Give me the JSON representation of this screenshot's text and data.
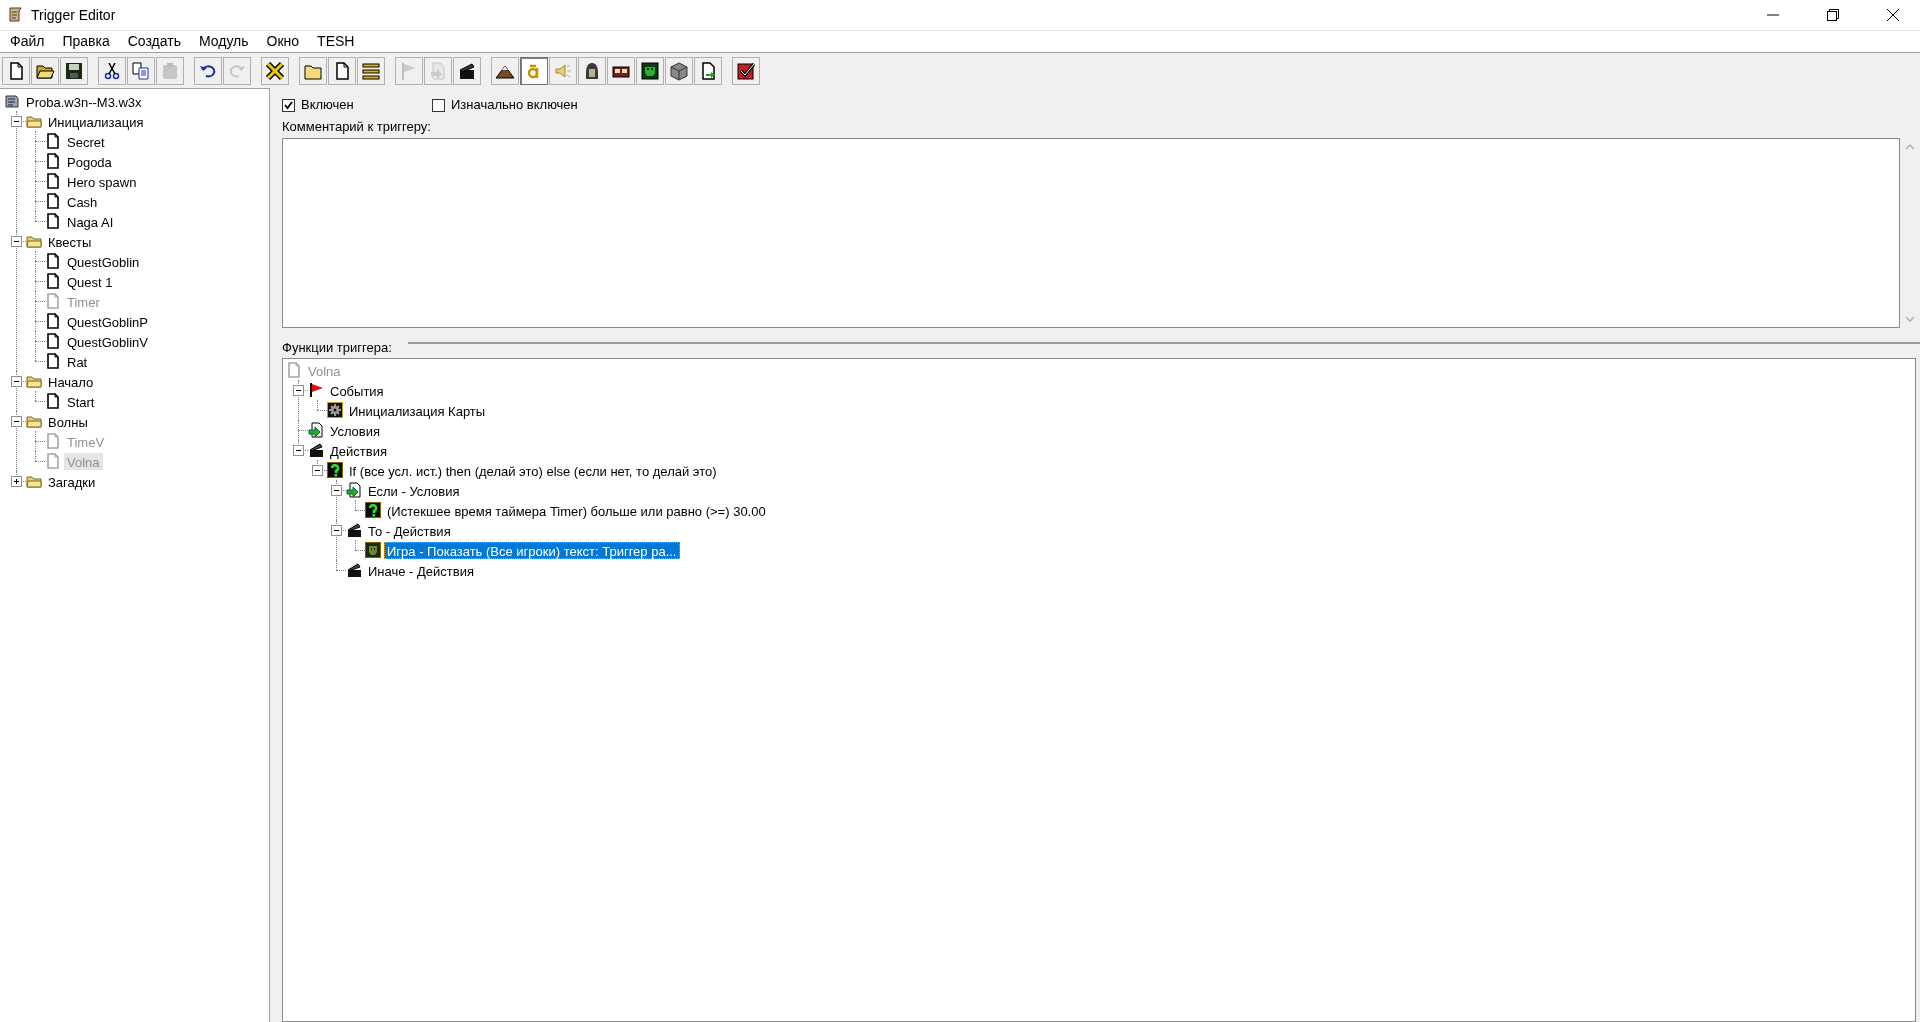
{
  "window": {
    "title": "Trigger Editor"
  },
  "menu": [
    "Файл",
    "Правка",
    "Создать",
    "Модуль",
    "Окно",
    "TESH"
  ],
  "toolbar": [
    [
      {
        "kind": "new",
        "disabled": false,
        "pressed": false
      },
      {
        "kind": "open",
        "disabled": false,
        "pressed": false
      },
      {
        "kind": "save",
        "disabled": false,
        "pressed": false
      }
    ],
    [
      {
        "kind": "cut",
        "disabled": false,
        "pressed": false
      },
      {
        "kind": "copy",
        "disabled": false,
        "pressed": false
      },
      {
        "kind": "paste",
        "disabled": true,
        "pressed": false
      }
    ],
    [
      {
        "kind": "undo",
        "disabled": false,
        "pressed": false
      },
      {
        "kind": "redo",
        "disabled": true,
        "pressed": false
      }
    ],
    [
      {
        "kind": "cross",
        "disabled": false,
        "pressed": false
      }
    ],
    [
      {
        "kind": "folder",
        "disabled": false,
        "pressed": false
      },
      {
        "kind": "page",
        "disabled": false,
        "pressed": false
      },
      {
        "kind": "list",
        "disabled": false,
        "pressed": false
      }
    ],
    [
      {
        "kind": "flag",
        "disabled": true,
        "pressed": false
      },
      {
        "kind": "condition",
        "disabled": true,
        "pressed": false
      },
      {
        "kind": "action",
        "disabled": false,
        "pressed": false
      }
    ],
    [
      {
        "kind": "terrain",
        "disabled": false,
        "pressed": false
      },
      {
        "kind": "letter",
        "disabled": false,
        "pressed": true
      },
      {
        "kind": "sound",
        "disabled": false,
        "pressed": false
      },
      {
        "kind": "unit",
        "disabled": false,
        "pressed": false
      },
      {
        "kind": "item",
        "disabled": false,
        "pressed": false
      },
      {
        "kind": "ai",
        "disabled": false,
        "pressed": false
      },
      {
        "kind": "object",
        "disabled": false,
        "pressed": false
      },
      {
        "kind": "import",
        "disabled": false,
        "pressed": false
      }
    ],
    [
      {
        "kind": "test",
        "disabled": false,
        "pressed": false
      }
    ]
  ],
  "map_tree": {
    "kind": "map",
    "label": "Proba.w3n--M3.w3x",
    "selected": false,
    "children": [
      {
        "kind": "folder",
        "label": "Инициализация",
        "selected": false,
        "expanded": true,
        "children": [
          {
            "kind": "trigger",
            "label": "Secret",
            "disabled": false,
            "selected": false
          },
          {
            "kind": "trigger",
            "label": "Pogoda",
            "disabled": false,
            "selected": false
          },
          {
            "kind": "trigger",
            "label": "Hero spawn",
            "disabled": false,
            "selected": false
          },
          {
            "kind": "trigger",
            "label": "Cash",
            "disabled": false,
            "selected": false
          },
          {
            "kind": "trigger",
            "label": "Naga AI",
            "disabled": false,
            "selected": false
          }
        ]
      },
      {
        "kind": "folder",
        "label": "Квесты",
        "selected": false,
        "expanded": true,
        "children": [
          {
            "kind": "trigger",
            "label": "QuestGoblin",
            "disabled": false,
            "selected": false
          },
          {
            "kind": "trigger",
            "label": "Quest 1",
            "disabled": false,
            "selected": false
          },
          {
            "kind": "trigger",
            "label": "Timer",
            "disabled": true,
            "selected": false
          },
          {
            "kind": "trigger",
            "label": "QuestGoblinP",
            "disabled": false,
            "selected": false
          },
          {
            "kind": "trigger",
            "label": "QuestGoblinV",
            "disabled": false,
            "selected": false
          },
          {
            "kind": "trigger",
            "label": "Rat",
            "disabled": false,
            "selected": false
          }
        ]
      },
      {
        "kind": "folder",
        "label": "Начало",
        "selected": false,
        "expanded": true,
        "children": [
          {
            "kind": "trigger",
            "label": "Start",
            "disabled": false,
            "selected": false
          }
        ]
      },
      {
        "kind": "folder",
        "label": "Волны",
        "selected": false,
        "expanded": true,
        "children": [
          {
            "kind": "trigger",
            "label": "TimeV",
            "disabled": true,
            "selected": false
          },
          {
            "kind": "trigger",
            "label": "Volna",
            "disabled": true,
            "selected": true
          }
        ]
      },
      {
        "kind": "folder",
        "label": "Загадки",
        "selected": false,
        "expanded": false
      }
    ]
  },
  "options": [
    {
      "label": "Включен",
      "checked": true
    },
    {
      "label": "Изначально включен",
      "checked": false
    }
  ],
  "comment": {
    "label": "Комментарий к триггеру:"
  },
  "functions": {
    "label": "Функции триггера:",
    "tree": {
      "kind": "trigger",
      "label": "Volna",
      "disabled": true,
      "selected": false,
      "children": [
        {
          "kind": "events",
          "label": "События",
          "selected": false,
          "expanded": true,
          "children": [
            {
              "kind": "event",
              "label": "Инициализация Карты",
              "selected": false
            }
          ]
        },
        {
          "kind": "conditions",
          "label": "Условия",
          "selected": false
        },
        {
          "kind": "actions",
          "label": "Действия",
          "selected": false,
          "expanded": true,
          "children": [
            {
              "kind": "question",
              "label": "If (все усл. ист.) then (делай это) else (если нет, то делай это)",
              "selected": false,
              "expanded": true,
              "children": [
                {
                  "kind": "conditions",
                  "label": "Если - Условия",
                  "selected": false,
                  "expanded": true,
                  "children": [
                    {
                      "kind": "question",
                      "label": "(Истекшее время таймера Timer) больше или равно (>=) 30.00",
                      "selected": false
                    }
                  ]
                },
                {
                  "kind": "actions",
                  "label": "То - Действия",
                  "selected": false,
                  "expanded": true,
                  "children": [
                    {
                      "kind": "action",
                      "label": "Игра - Показать (Все игроки) текст: Триггер ра...",
                      "selected": true
                    }
                  ]
                },
                {
                  "kind": "actions",
                  "label": "Иначе - Действия",
                  "selected": false
                }
              ]
            }
          ]
        }
      ]
    }
  }
}
